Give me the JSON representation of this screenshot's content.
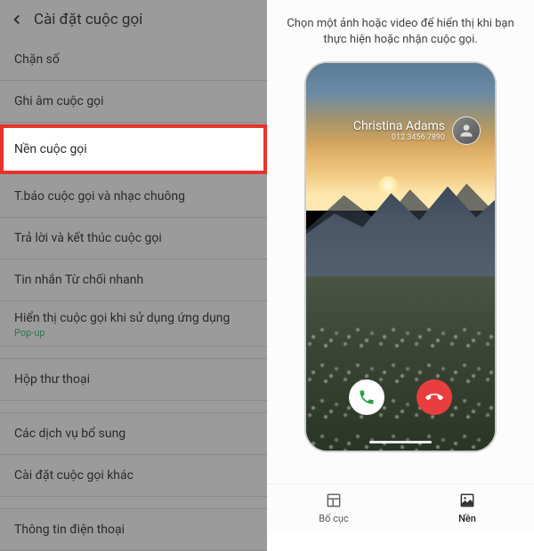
{
  "left": {
    "title": "Cài đặt cuộc gọi",
    "items": [
      {
        "label": "Chặn số"
      },
      {
        "label": "Ghi âm cuộc gọi"
      },
      {
        "label": "Nền cuộc gọi",
        "highlighted": true
      },
      {
        "label": "T.báo cuộc gọi và nhạc chuông"
      },
      {
        "label": "Trả lời và kết thúc cuộc gọi"
      },
      {
        "label": "Tin nhắn Từ chối nhanh"
      },
      {
        "label": "Hiển thị cuộc gọi khi sử dụng ứng dụng",
        "sub": "Pop-up"
      },
      {
        "gap": true
      },
      {
        "label": "Hộp thư thoại"
      },
      {
        "gap": true
      },
      {
        "label": "Các dịch vụ bổ sung"
      },
      {
        "label": "Cài đặt cuộc gọi khác"
      },
      {
        "gap": true
      },
      {
        "label": "Thông tin điện thoại"
      }
    ]
  },
  "right": {
    "description": "Chọn một ảnh hoặc video để hiển thị khi bạn thực hiện hoặc nhận cuộc gọi.",
    "caller": {
      "name": "Christina Adams",
      "number": "012 3456 7890"
    },
    "nav": {
      "layout": "Bố cục",
      "background": "Nền"
    }
  }
}
